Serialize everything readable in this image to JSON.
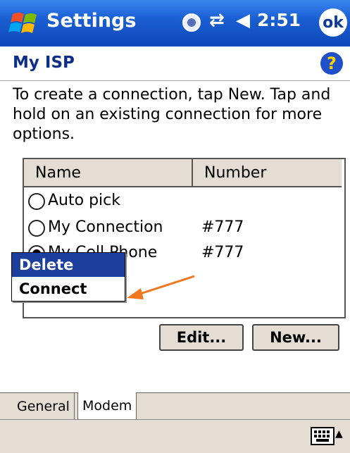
{
  "titlebar": {
    "title": "Settings",
    "clock": "2:51",
    "ok": "ok"
  },
  "heading": {
    "title": "My ISP",
    "help": "?"
  },
  "instructions": "To create a connection, tap New. Tap and hold on an existing connection for more options.",
  "list": {
    "columns": [
      "Name",
      "Number"
    ],
    "rows": [
      {
        "name": "Auto pick",
        "number": "",
        "selected": false
      },
      {
        "name": "My Connection",
        "number": "#777",
        "selected": false
      },
      {
        "name": "My Cell Phone",
        "number": "#777",
        "selected": true
      }
    ]
  },
  "context_menu": {
    "items": [
      "Delete",
      "Connect"
    ]
  },
  "buttons": {
    "edit": "Edit...",
    "new": "New..."
  },
  "tabs": [
    "General",
    "Modem"
  ],
  "colors": {
    "titlebar": "#1a5fd3",
    "accent": "#1c3f9e",
    "annotation_arrow": "#f07820"
  },
  "icons": [
    "windows-start-icon",
    "status-icon",
    "connectivity-icon",
    "volume-icon",
    "help-icon",
    "keyboard-icon"
  ]
}
